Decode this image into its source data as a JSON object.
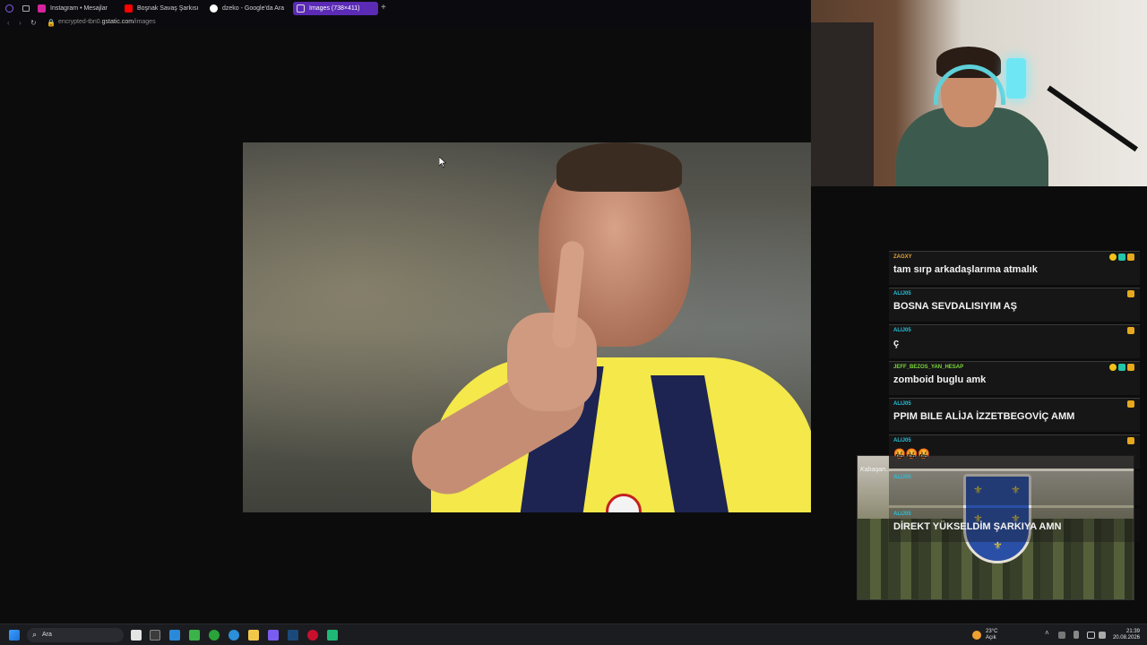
{
  "browser": {
    "tabs": [
      {
        "label": "Instagram • Mesajlar",
        "icon": "instagram-icon",
        "color": "#d6249f"
      },
      {
        "label": "Boşnak Savaş Şarkısı",
        "icon": "youtube-icon",
        "color": "#ff0000"
      },
      {
        "label": "dzeko - Google'da Ara",
        "icon": "google-icon",
        "color": "#ffffff"
      },
      {
        "label": "Images (738×411)",
        "icon": "page-icon",
        "color": "#cccccc"
      }
    ],
    "new_tab": "+",
    "url_prefix": "encrypted-tbn0.",
    "url_domain": "gstatic.com",
    "url_path": "/images"
  },
  "chat": {
    "messages": [
      {
        "user": "ZAGXY",
        "color": "#e4a33a",
        "text": "tam sırp arkadaşlarıma atmalık"
      },
      {
        "user": "ALIJ05",
        "color": "#26c0d8",
        "text": "BOSNA SEVDALISIYIM AŞ"
      },
      {
        "user": "ALIJ05",
        "color": "#26c0d8",
        "text": "ç"
      },
      {
        "user": "JEFF_BEZOS_YAN_HESAP",
        "color": "#7cd83a",
        "text": "zomboid buglu amk"
      },
      {
        "user": "ALIJ05",
        "color": "#26c0d8",
        "text": "PPIM BILE ALİJA İZZETBEGOVİÇ AMM"
      },
      {
        "user": "ALIJ05",
        "color": "#26c0d8",
        "text": "🤬🤬🤬"
      },
      {
        "user": "ALIJ05",
        "color": "#26c0d8",
        "text": ""
      },
      {
        "user": "ALIJ05",
        "color": "#26c0d8",
        "text": "DİREKT YÜKSELDİM ŞARKIYA AMN"
      }
    ]
  },
  "overlay": {
    "label": "Kabaqan..."
  },
  "taskbar": {
    "search_label": "Ara",
    "weather_temp": "23°C",
    "weather_desc": "Açık",
    "time": "21:39",
    "date": "20.08.2026"
  }
}
